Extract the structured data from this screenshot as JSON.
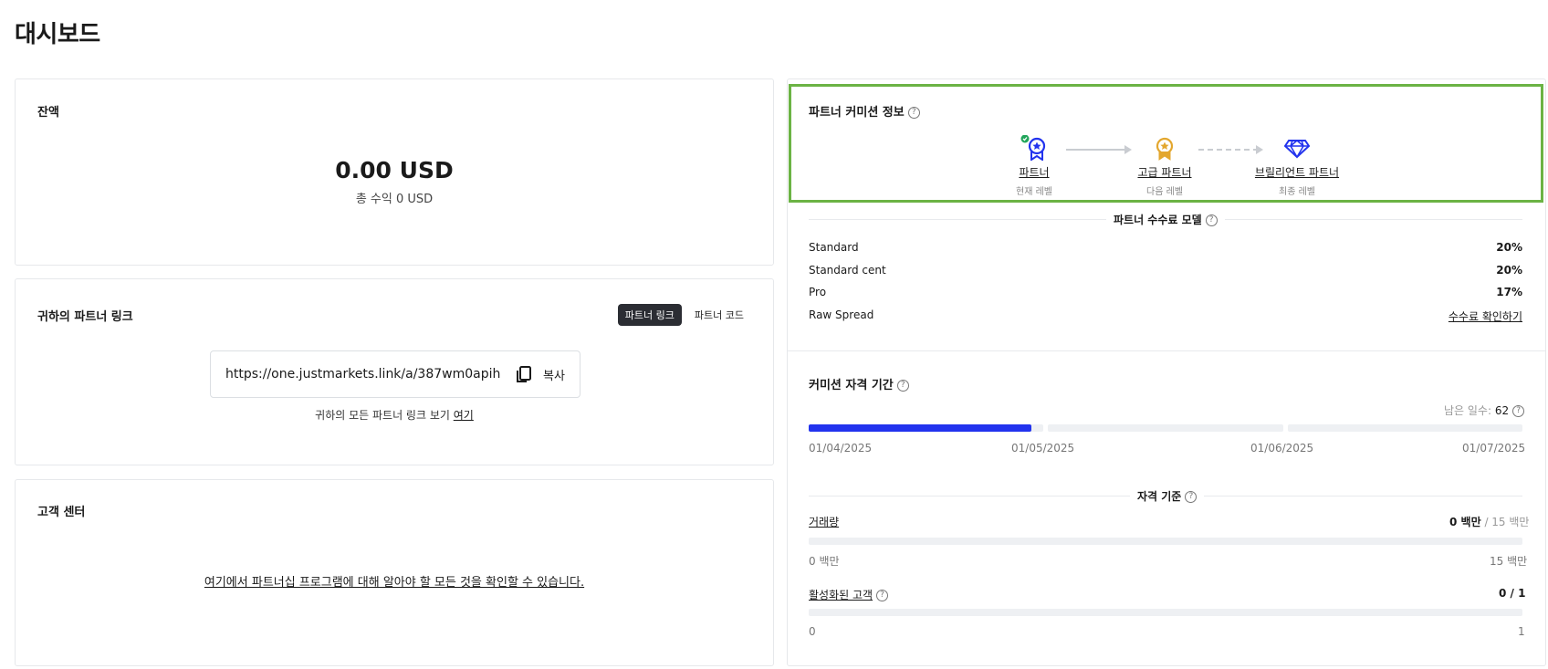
{
  "page": {
    "title": "대시보드"
  },
  "balance": {
    "title": "잔액",
    "amount": "0.00 USD",
    "total_earnings": "총 수익 0 USD"
  },
  "partner_link": {
    "title": "귀하의 파트너 링크",
    "tabs": [
      "파트너 링크",
      "파트너 코드"
    ],
    "active_tab": "파트너 링크",
    "url": "https://one.justmarkets.link/a/387wm0apih",
    "copy_label": "복사",
    "all_links_text": "귀하의 모든 파트너 링크 보기",
    "all_links_link": "여기"
  },
  "help_center": {
    "title": "고객 센터",
    "link": "여기에서 파트너십 프로그램에 대해 알아야 할 모든 것을 확인할 수 있습니다."
  },
  "commission_info": {
    "title": "파트너 커미션 정보",
    "levels": [
      {
        "name": "파트너",
        "sub": "현재 레벨",
        "color": "#2233ee",
        "icon": "medal-icon"
      },
      {
        "name": "고급 파트너",
        "sub": "다음 레벨",
        "color": "#e3a72f",
        "icon": "medal-icon"
      },
      {
        "name": "브릴리언트 파트너",
        "sub": "최종 레벨",
        "color": "#2233ee",
        "icon": "diamond-icon"
      }
    ]
  },
  "fee_model": {
    "title": "파트너 수수료 모델",
    "rows": [
      {
        "label": "Standard",
        "value": "20%"
      },
      {
        "label": "Standard cent",
        "value": "20%"
      },
      {
        "label": "Pro",
        "value": "17%"
      },
      {
        "label": "Raw Spread",
        "value": "수수료 확인하기"
      }
    ]
  },
  "qualification_period": {
    "title": "커미션 자격 기간",
    "days_left_label": "남은 일수:",
    "days_left": "62",
    "progress_fraction": 0.95,
    "dates": [
      "01/04/2025",
      "01/05/2025",
      "01/06/2025",
      "01/07/2025"
    ]
  },
  "criteria": {
    "title": "자격 기준",
    "volume": {
      "label": "거래량",
      "current": "0 백만",
      "target": "/ 15 백만",
      "min": "0 백만",
      "max": "15 백만",
      "fraction": 0
    },
    "clients": {
      "label": "활성화된 고객",
      "value": "0 / 1",
      "min": "0",
      "max": "1",
      "fraction": 0
    }
  },
  "colors": {
    "accent": "#2233ee",
    "highlight": "#6bb344",
    "gold": "#e3a72f",
    "check": "#22a55b"
  }
}
